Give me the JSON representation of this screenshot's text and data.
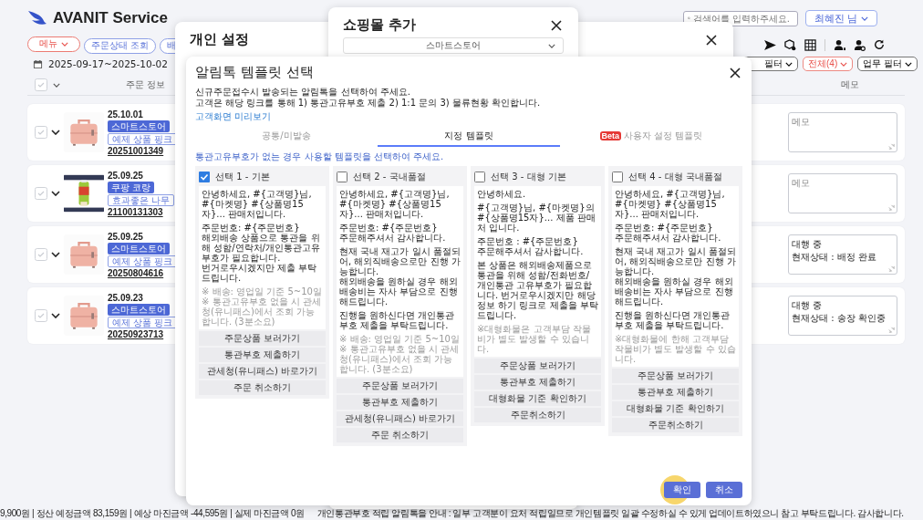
{
  "app": {
    "title": "AVANIT Service"
  },
  "search": {
    "placeholder": "검색어를 입력하주세요."
  },
  "user_button": "최혜진 님",
  "menu_pills": [
    {
      "label": "메뉴",
      "kind": "menu"
    },
    {
      "label": "주문상태 조회",
      "kind": "link"
    },
    {
      "label": "배",
      "kind": "link"
    }
  ],
  "date_range": "2025-09-17~2025-10-02",
  "filters": [
    {
      "label": "필터",
      "kind": "plain"
    },
    {
      "label": "전체(4)",
      "kind": "alert"
    },
    {
      "label": "업무 필터",
      "kind": "plain"
    }
  ],
  "table": {
    "select_all": {
      "checked": false
    },
    "columns": [
      "주문 정보",
      "메모"
    ],
    "rows": [
      {
        "checked": false,
        "date": "25.10.01",
        "platform": "스마트스토어",
        "product": "예제 상품 핑크",
        "order_no": "20251001349",
        "memo": {
          "placeholder": "메모"
        }
      },
      {
        "checked": false,
        "date": "25.09.25",
        "platform": "쿠팡 코랑",
        "product": "효과좋은 나무",
        "order_no": "21100131303",
        "memo": {
          "placeholder": "메모"
        }
      },
      {
        "checked": false,
        "date": "25.09.25",
        "platform": "스마트스토어",
        "product": "예제 상품 핑크",
        "order_no": "20250804616",
        "memo": {
          "value": "대행 중\n현재상태 : 배정 완료"
        }
      },
      {
        "checked": false,
        "date": "25.09.23",
        "platform": "스마트스토어",
        "product": "예제 상품 핑크",
        "order_no": "20250923713",
        "memo": {
          "value": "대행 중\n현재상태 : 송장 확인중"
        }
      }
    ]
  },
  "settings_modal": {
    "title": "개인 설정"
  },
  "shop_modal": {
    "title": "쇼핑몰 추가",
    "dropdown": "스마트스토어"
  },
  "template_modal": {
    "title": "알림톡 템플릿 선택",
    "intro": [
      "신규주문접수시 발송되는 알림톡을 선택하여 주세요.",
      "고객은 해당 링크를 통해 1) 통관고유부호 제출 2) 1:1 문의 3) 물류현황 확인합니다."
    ],
    "preview_link": "고객화면 미리보기",
    "tabs": [
      {
        "label": "공통/미발송",
        "selected": false
      },
      {
        "label": "지정 템플릿",
        "selected": true
      },
      {
        "label": "사용자 설정 템플릿",
        "badge": "Beta",
        "selected": false
      }
    ],
    "hint": "통관고유부호가 없는 경우 사용할 템플릿을 선택하여 주세요.",
    "templates": [
      {
        "title": "선택 1 - 기본",
        "checked": true,
        "paragraphs": [
          "안녕하세요, #{고객명}님,\n#{마켓명} #{상품명15자}... 판매처입니다.",
          "주문번호: #{주문번호}\n해외배송 상품으로 통관을 위해 성함/연락처/개인통관고유부호가 필요합니다.\n번거로우시겠지만 제출 부탁드립니다."
        ],
        "notes": "※ 배송: 영업일 기준 5~10일\n※ 통관고유부호 없을 시 관세청(유니패스)에서 조회 가능합니다. (3분소요)",
        "buttons": [
          "주문상품 보러가기",
          "통관부호 제출하기",
          "관세청(유니패스) 바로가기",
          "주문 취소하기"
        ]
      },
      {
        "title": "선택 2 - 국내품절",
        "checked": false,
        "paragraphs": [
          "안녕하세요, #{고객명}님,\n#{마켓명} #{상품명15자}... 판매처입니다.",
          "주문번호: #{주문번호}\n주문해주셔서 감사합니다.",
          "현재 국내 재고가 일시 품절되어, 해외직배송으로만 진행 가능합니다.\n해외배송을 원하실 경우 해외 배송비는 자사 부담으로 진행해드립니다.",
          "진행을 원하신다면 개인통관부호 제출을 부탁드립니다."
        ],
        "notes": "※ 배송: 영업일 기준 5~10일\n※ 통관고유부호 없을 시 관세청(유니패스)에서 조회 가능합니다. (3분소요)",
        "buttons": [
          "주문상품 보러가기",
          "통관부호 제출하기",
          "관세청(유니패스) 바로가기",
          "주문 취소하기"
        ]
      },
      {
        "title": "선택 3 - 대형 기본",
        "checked": false,
        "paragraphs": [
          "안녕하세요.",
          "#{고객명}님, #{마켓명}의 #{상품명15자}... 제품 판매처 입니다.",
          "주문번호 : #{주문번호}\n주문해주셔서 감사합니다.",
          "본 상품은 해외배송제품으로 통관을 위해 성함/전화번호/개인통관 고유부호가 필요합니다. 번거로우시겠지만 해당 정보 하기 링크로 제출을 부탁드립니다."
        ],
        "notes": "※대형화물은 고객부담 작물비가 별도 발생할 수 있습니다.",
        "buttons": [
          "주문상품 보러가기",
          "통관부호 제출하기",
          "대형화물 기준 확인하기",
          "주문취소하기"
        ]
      },
      {
        "title": "선택 4 - 대형 국내품절",
        "checked": false,
        "paragraphs": [
          "안녕하세요, #{고객명}님,\n#{마켓명} #{상품명15자}... 판매처입니다.",
          "주문번호: #{주문번호}\n주문해주셔서 감사합니다.",
          "현재 국내 재고가 일시 품절되어, 해외직배송으로만 진행 가능합니다.\n해외배송을 원하실 경우 해외 배송비는 자사 부담으로 진행해드립니다.",
          "진행을 원하신다면 개인통관부호 제출을 부탁드립니다."
        ],
        "notes": "※대형화물에 한해 고객부담 작물비가 별도 발생할 수 있습니다.",
        "buttons": [
          "주문상품 보러가기",
          "통관부호 제출하기",
          "대형화물 기준 확인하기",
          "주문취소하기"
        ]
      }
    ],
    "confirm_button": "확인",
    "cancel_button": "취소"
  },
  "status_bar": {
    "summary": "9,900원 | 정산 예정금액 83,159원 | 예상 마진금액 -44,595원 | 실제 마진금액 0원",
    "notice": "개인통관부호 적립 알림톡을 안내 : 일부 고객분이 요처 적립일므로 개인템플릿 일괄 수정하실 수 있게 업데이트하였으니 참고 부탁드립니다. 감사합니다."
  }
}
